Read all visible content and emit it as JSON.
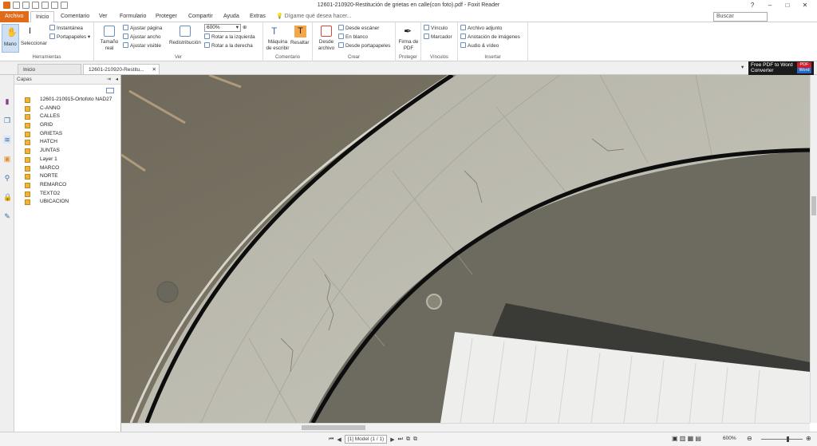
{
  "window": {
    "title": "12601-210920-Restitución de grietas en calle(con foto).pdf - Foxit Reader",
    "controls": [
      "?",
      "–",
      "□",
      "✕"
    ]
  },
  "menu": {
    "archivo": "Archivo",
    "items": [
      "Inicio",
      "Comentario",
      "Ver",
      "Formulario",
      "Proteger",
      "Compartir",
      "Ayuda",
      "Extras"
    ],
    "tell_me": "Dígame qué desea hacer...",
    "search_placeholder": "Buscar"
  },
  "ribbon": {
    "herramientas": {
      "label": "Herramientas",
      "mano": "Mano",
      "seleccionar": "Seleccionar",
      "instantanea": "Instantánea",
      "portapapeles": "Portapapeles"
    },
    "ver": {
      "label": "Ver",
      "tamano_real": "Tamaño real",
      "ajustar_pagina": "Ajustar página",
      "ajustar_ancho": "Ajustar ancho",
      "ajustar_visible": "Ajustar visible",
      "redistribucion": "Redistribución",
      "zoom_value": "600%",
      "rotar_izq": "Rotar a la izquierda",
      "rotar_der": "Rotar a la derecha"
    },
    "comentario": {
      "label": "Comentario",
      "maquina": "Máquina de escribir",
      "resaltar": "Resaltar"
    },
    "crear": {
      "label": "Crear",
      "desde_archivo": "Desde archivo",
      "desde_escaner": "Desde escáner",
      "en_blanco": "En blanco",
      "desde_portapapeles": "Desde portapapeles"
    },
    "proteger": {
      "label": "Proteger",
      "firma": "Firma de PDF"
    },
    "vinculos": {
      "label": "Vínculos",
      "vinculo": "Vínculo",
      "marcador": "Marcador"
    },
    "insertar": {
      "label": "Insertar",
      "archivo_adjunto": "Archivo adjunto",
      "anotacion_imagenes": "Anotación de imágenes",
      "audio_video": "Audio & vídeo"
    }
  },
  "tabs": [
    {
      "label": "Inicio"
    },
    {
      "label": "12601-210920-Restitu..."
    }
  ],
  "ad": {
    "line1": "Free PDF to Word",
    "line2": "Converter",
    "badge1": "PDF",
    "badge2": "Word"
  },
  "panel": {
    "title": "Capas",
    "layers": [
      "12601-210915-Ortofoto NAD27",
      "C-ANNO",
      "CALLES",
      "GRID",
      "GRIETAS",
      "HATCH",
      "JUNTAS",
      "Layer 1",
      "MARCO",
      "NORTE",
      "REMARCO",
      "TEXTO2",
      "UBICACION"
    ]
  },
  "status": {
    "page": "[1] Model (1 / 1)",
    "zoom": "600%",
    "zoom_level": 0.65
  },
  "colors": {
    "accent": "#e06c1a",
    "checkbox": "#f0b43a"
  }
}
